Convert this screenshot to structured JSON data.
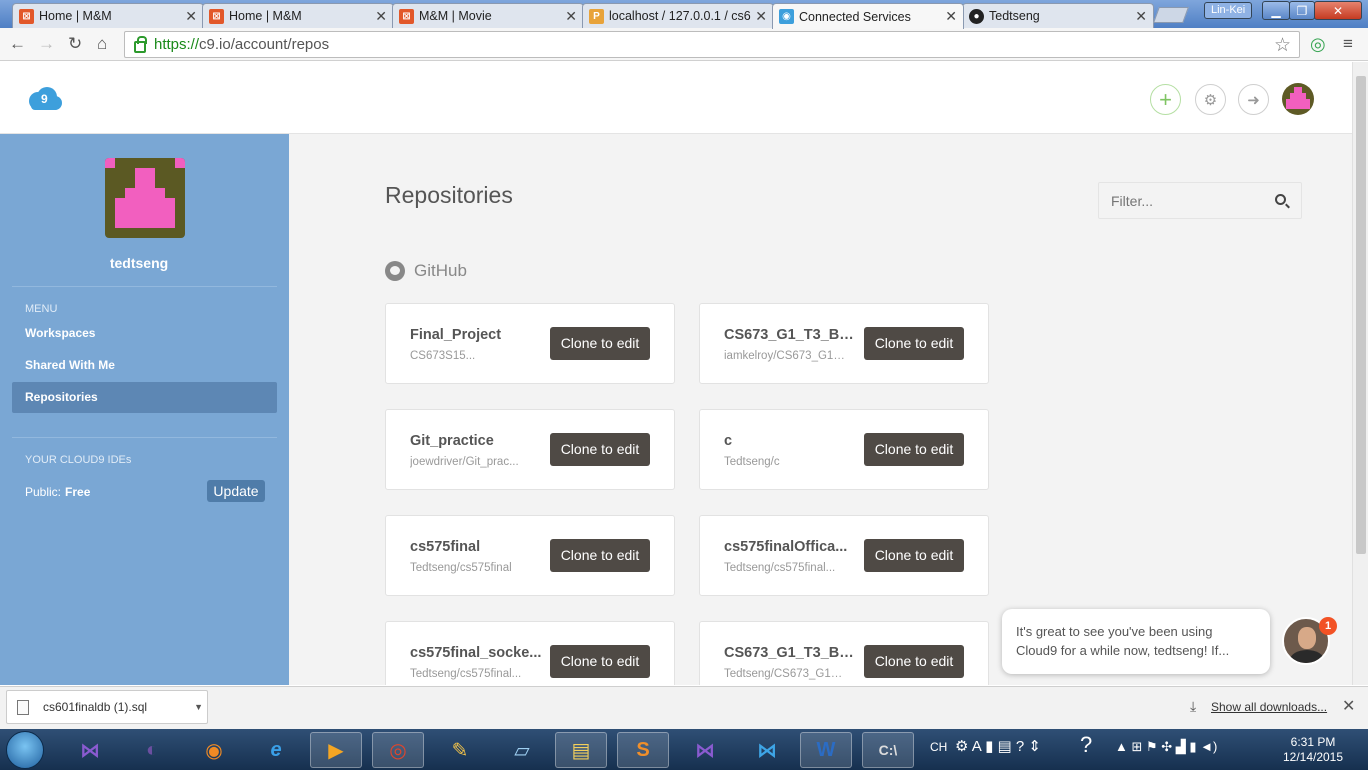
{
  "browser": {
    "tabs": [
      {
        "title": "Home | M&M",
        "active": false
      },
      {
        "title": "Home | M&M",
        "active": false
      },
      {
        "title": "M&M | Movie",
        "active": false
      },
      {
        "title": "localhost / 127.0.0.1 / cs6",
        "active": false
      },
      {
        "title": "Connected Services",
        "active": true
      },
      {
        "title": "Tedtseng",
        "active": false
      }
    ],
    "window_user": "Lin-Kei",
    "url_scheme": "https://",
    "url_rest": "c9.io/account/repos"
  },
  "sidebar": {
    "username": "tedtseng",
    "menu_heading": "MENU",
    "menu_items": [
      {
        "label": "Workspaces",
        "active": false
      },
      {
        "label": "Shared With Me",
        "active": false
      },
      {
        "label": "Repositories",
        "active": true
      }
    ],
    "ides_heading": "YOUR CLOUD9 IDEs",
    "plan_label": "Public:",
    "plan_value": "Free",
    "update_label": "Update"
  },
  "main": {
    "title": "Repositories",
    "filter_placeholder": "Filter...",
    "provider": "GitHub",
    "clone_label": "Clone to edit",
    "repos": [
      {
        "name": "Final_Project",
        "sub": "CS673S15..."
      },
      {
        "name": "CS673_G1_T3_BU...",
        "sub": "iamkelroy/CS673_G1_..."
      },
      {
        "name": "Git_practice",
        "sub": "joewdriver/Git_prac..."
      },
      {
        "name": "c",
        "sub": "Tedtseng/c"
      },
      {
        "name": "cs575final",
        "sub": "Tedtseng/cs575final"
      },
      {
        "name": "cs575finalOffica...",
        "sub": "Tedtseng/cs575final..."
      },
      {
        "name": "cs575final_socke...",
        "sub": "Tedtseng/cs575final..."
      },
      {
        "name": "CS673_G1_T3_BU...",
        "sub": "Tedtseng/CS673_G1_T..."
      }
    ]
  },
  "chat": {
    "line1": "It's great to see you've been using",
    "line2": "Cloud9 for a while now, tedtseng! If...",
    "badge": "1"
  },
  "downloads": {
    "file": "cs601finaldb (1).sql",
    "show_all": "Show all downloads..."
  },
  "taskbar": {
    "lang": "CH",
    "time": "6:31 PM",
    "date": "12/14/2015"
  }
}
